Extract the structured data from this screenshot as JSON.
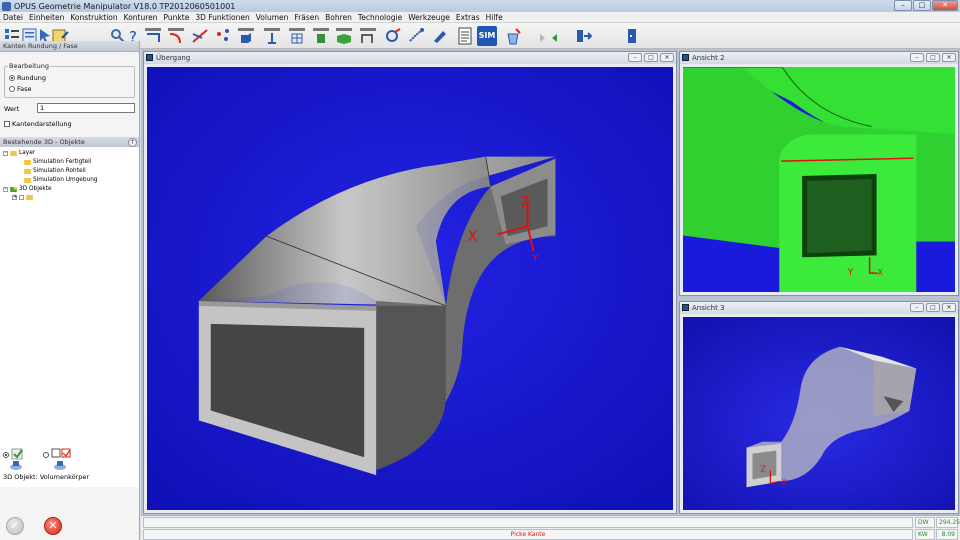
{
  "window": {
    "title": "OPUS Geometrie Manipulator V18.0   TP2012060501001",
    "minimize": "–",
    "maximize": "□",
    "close": "✕"
  },
  "menu": [
    "Datei",
    "Einheiten",
    "Konstruktion",
    "Konturen",
    "Punkte",
    "3D Funktionen",
    "Volumen",
    "Fräsen",
    "Bohren",
    "Technologie",
    "Werkzeuge",
    "Extras",
    "Hilfe"
  ],
  "toolbar": {
    "sim_label": "SIM",
    "icons": [
      "layer-tree-icon",
      "layer-list-icon",
      "select-icon",
      "properties-icon",
      "wrench-icon",
      "help-icon",
      "move-icon",
      "rounding-icon",
      "trim-icon",
      "points-icon",
      "3d-box-icon",
      "3d-extrude-icon",
      "3d-grid-icon",
      "3d-cylinder-icon",
      "3d-solid-icon",
      "surface-icon",
      "analysis-icon",
      "drill-icon",
      "nc-code-icon",
      "sim-icon",
      "tool-icon",
      "redo-icon",
      "undo-icon",
      "export-icon",
      "exit-icon"
    ]
  },
  "left_panel": {
    "header": "Kanten Rundung / Fase",
    "groupbox_label": "Bearbeitung",
    "option_rundung": "Rundung",
    "option_fase": "Fase",
    "wert_label": "Wert",
    "wert_value": "1",
    "kanten_label": "Kantendarstellung",
    "objects_header": "Bestehende 3D - Objekte",
    "objects_header_icon": "↑",
    "tree": {
      "layer": "Layer",
      "sim_fertig": "Simulation Fertigteil",
      "sim_roh": "Simulation Rohteil",
      "sim_umg": "Simulation Umgebung",
      "objekte": "3D Objekte"
    },
    "selected_object": "3D Objekt: Volumenkörper"
  },
  "viewports": {
    "main_title": "Übergang",
    "view2_title": "Ansicht 2",
    "view3_title": "Ansicht 3",
    "axis_x": "X",
    "axis_y": "Y",
    "axis_z": "Z",
    "colors": {
      "main_bg": "#1a1adc",
      "view2_bg": "#1a1adc",
      "part_green": "#33e033",
      "part_grey": "#8e8e8e",
      "axis_red": "#e01010"
    }
  },
  "statusbar": {
    "hint": "Picke Kante",
    "dw_label": "DW",
    "dw_value": "294.25",
    "kw_label": "KW",
    "kw_value": "8.09"
  }
}
